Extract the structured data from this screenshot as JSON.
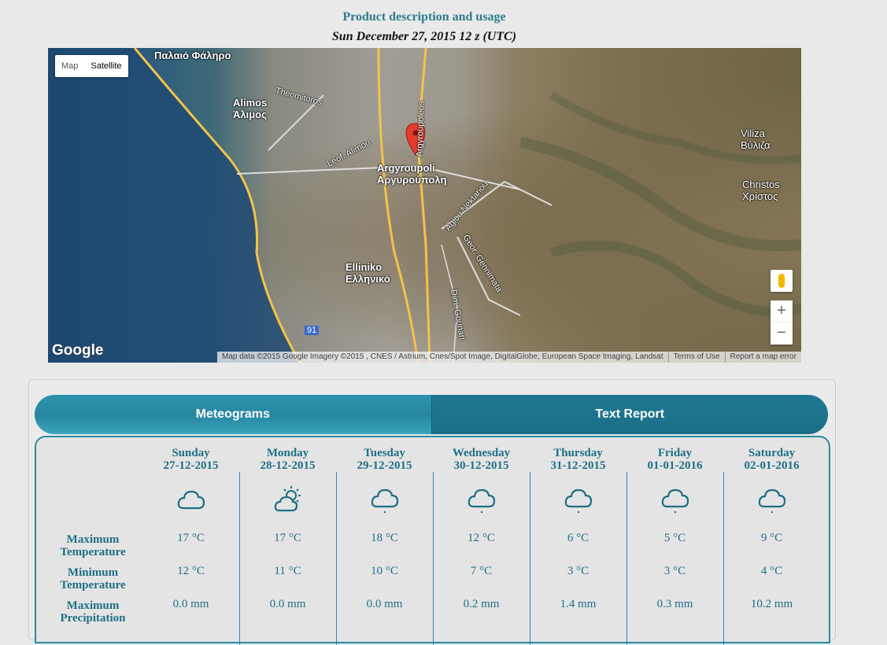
{
  "header": {
    "description_link": "Product description and usage",
    "date": "Sun December 27, 2015 12 z (UTC)"
  },
  "map": {
    "type_controls": [
      "Map",
      "Satellite"
    ],
    "labels": [
      {
        "text": "Παλαιό Φάληρο",
        "kind": "town"
      },
      {
        "text": "Alimos\nΆλιμος",
        "kind": "town"
      },
      {
        "text": "Theomitoros",
        "kind": "street"
      },
      {
        "text": "Leof. Alimou",
        "kind": "street"
      },
      {
        "text": "Argyroupoleos",
        "kind": "street"
      },
      {
        "text": "Argyroupoli\nΑργυρούπολη",
        "kind": "town"
      },
      {
        "text": "Agiou Nektariou",
        "kind": "street"
      },
      {
        "text": "Geor. Gennimata",
        "kind": "street"
      },
      {
        "text": "Elliniko\nΕλληνικό",
        "kind": "town"
      },
      {
        "text": "Dim. Gounari",
        "kind": "street"
      },
      {
        "text": "Viliza\nΒύλιζα",
        "kind": "town"
      },
      {
        "text": "Christos\nΧρίστος",
        "kind": "town"
      },
      {
        "text": "91",
        "kind": "route"
      }
    ],
    "logo": "Google",
    "attribution": [
      "Map data ©2015 Google Imagery ©2015 , CNES / Astrium, Cnes/Spot Image, DigitalGlobe, European Space Imaging, Landsat",
      "Terms of Use",
      "Report a map error"
    ],
    "zoom_in": "+",
    "zoom_out": "−"
  },
  "tabs": [
    "Meteograms",
    "Text Report"
  ],
  "report": {
    "days": [
      {
        "day": "Sunday",
        "date": "27-12-2015",
        "icon": "cloud-icon",
        "max_temp": "17 °C",
        "min_temp": "12 °C",
        "precip": "0.0 mm"
      },
      {
        "day": "Monday",
        "date": "28-12-2015",
        "icon": "partly-cloudy-icon",
        "max_temp": "17 °C",
        "min_temp": "11 °C",
        "precip": "0.0 mm"
      },
      {
        "day": "Tuesday",
        "date": "29-12-2015",
        "icon": "light-rain-icon",
        "max_temp": "18 °C",
        "min_temp": "10 °C",
        "precip": "0.0 mm"
      },
      {
        "day": "Wednesday",
        "date": "30-12-2015",
        "icon": "light-rain-icon",
        "max_temp": "12 °C",
        "min_temp": "7 °C",
        "precip": "0.2 mm"
      },
      {
        "day": "Thursday",
        "date": "31-12-2015",
        "icon": "light-rain-icon",
        "max_temp": "6 °C",
        "min_temp": "3 °C",
        "precip": "1.4 mm"
      },
      {
        "day": "Friday",
        "date": "01-01-2016",
        "icon": "light-rain-icon",
        "max_temp": "5 °C",
        "min_temp": "3 °C",
        "precip": "0.3 mm"
      },
      {
        "day": "Saturday",
        "date": "02-01-2016",
        "icon": "light-rain-icon",
        "max_temp": "9 °C",
        "min_temp": "4 °C",
        "precip": "10.2 mm"
      }
    ],
    "row_labels": [
      "Maximum Temperature",
      "Minimum Temperature",
      "Maximum Precipitation"
    ]
  },
  "colors": {
    "accent": "#2a8aa3",
    "text": "#1e6f86"
  }
}
